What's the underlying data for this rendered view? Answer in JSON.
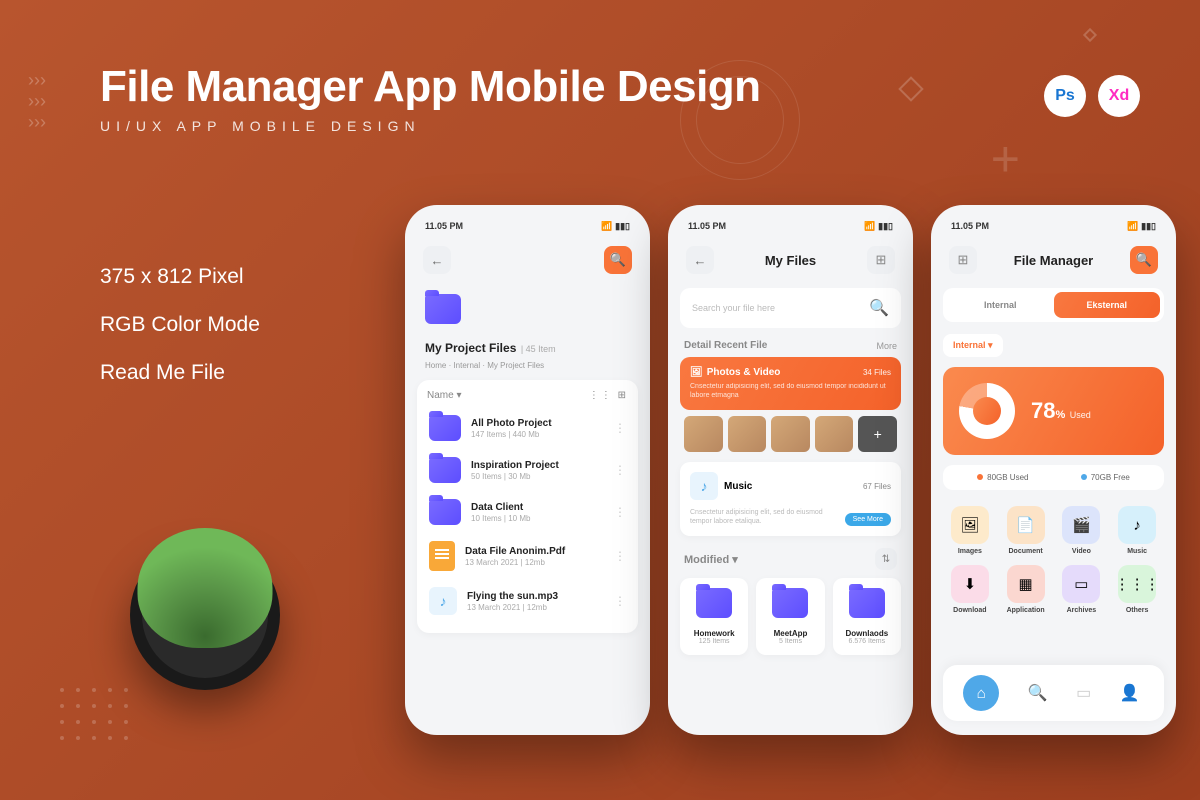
{
  "header": {
    "title": "File Manager App Mobile Design",
    "subtitle": "UI/UX APP MOBILE DESIGN"
  },
  "tool_badges": {
    "ps": "Ps",
    "xd": "Xd"
  },
  "features": [
    "375 x 812 Pixel",
    "RGB Color Mode",
    "Read Me File"
  ],
  "status": {
    "time": "11.05 PM"
  },
  "phone1": {
    "folder_title": "My Project Files",
    "item_count": "| 45 Item",
    "breadcrumb": "Home · Internal · My Project Files",
    "sort_label": "Name ▾",
    "files": [
      {
        "name": "All Photo Project",
        "meta": "147 Items | 440 Mb",
        "type": "folder"
      },
      {
        "name": "Inspiration Project",
        "meta": "50 Items | 30 Mb",
        "type": "folder"
      },
      {
        "name": "Data Client",
        "meta": "10 Items | 10 Mb",
        "type": "folder"
      },
      {
        "name": "Data File Anonim.Pdf",
        "meta": "13 March 2021 | 12mb",
        "type": "doc"
      },
      {
        "name": "Flying the sun.mp3",
        "meta": "13 March 2021 | 12mb",
        "type": "music"
      }
    ]
  },
  "phone2": {
    "title": "My Files",
    "search_placeholder": "Search your file here",
    "section1": "Detail Recent File",
    "more": "More",
    "photos": {
      "title": "Photos & Video",
      "count": "34 Files",
      "desc": "Cnsectetur adipisicing elit, sed do eiusmod tempor incididunt ut labore etmagna"
    },
    "music": {
      "title": "Music",
      "count": "67 Files",
      "desc": "Cnsectetur adipisicing elit, sed do eiusmod tempor labore etaliqua.",
      "cta": "See More"
    },
    "modified_label": "Modified ▾",
    "folders": [
      {
        "name": "Homework",
        "meta": "125 Items"
      },
      {
        "name": "MeetApp",
        "meta": "5 Items"
      },
      {
        "name": "Downlaods",
        "meta": "6.576 Items"
      }
    ]
  },
  "phone3": {
    "title": "File Manager",
    "tabs": {
      "internal": "Internal",
      "eksternal": "Eksternal"
    },
    "dropdown": "Internal ▾",
    "usage": {
      "pct": "78",
      "pct_suffix": "%",
      "label": "Used",
      "used": "80GB Used",
      "free": "70GB Free"
    },
    "categories": [
      {
        "name": "Images",
        "color": "#fdeacb",
        "icon": "🖼"
      },
      {
        "name": "Document",
        "color": "#fce3c7",
        "icon": "📄"
      },
      {
        "name": "Video",
        "color": "#dce4fb",
        "icon": "🎬"
      },
      {
        "name": "Music",
        "color": "#d6f0fb",
        "icon": "♪"
      },
      {
        "name": "Download",
        "color": "#fbdce8",
        "icon": "⬇"
      },
      {
        "name": "Application",
        "color": "#fbd7d0",
        "icon": "▦"
      },
      {
        "name": "Archives",
        "color": "#e5dbfb",
        "icon": "▭"
      },
      {
        "name": "Others",
        "color": "#d9f5db",
        "icon": "⋮⋮⋮"
      }
    ]
  }
}
